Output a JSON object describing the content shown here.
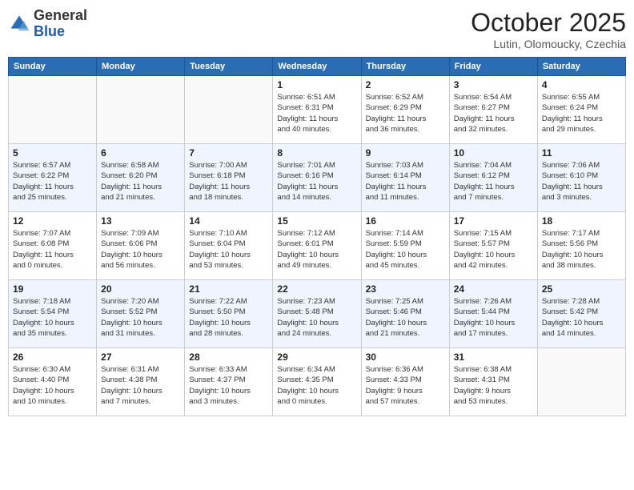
{
  "logo": {
    "general": "General",
    "blue": "Blue"
  },
  "header": {
    "month": "October 2025",
    "location": "Lutin, Olomoucky, Czechia"
  },
  "weekdays": [
    "Sunday",
    "Monday",
    "Tuesday",
    "Wednesday",
    "Thursday",
    "Friday",
    "Saturday"
  ],
  "weeks": [
    [
      {
        "day": "",
        "info": ""
      },
      {
        "day": "",
        "info": ""
      },
      {
        "day": "",
        "info": ""
      },
      {
        "day": "1",
        "info": "Sunrise: 6:51 AM\nSunset: 6:31 PM\nDaylight: 11 hours\nand 40 minutes."
      },
      {
        "day": "2",
        "info": "Sunrise: 6:52 AM\nSunset: 6:29 PM\nDaylight: 11 hours\nand 36 minutes."
      },
      {
        "day": "3",
        "info": "Sunrise: 6:54 AM\nSunset: 6:27 PM\nDaylight: 11 hours\nand 32 minutes."
      },
      {
        "day": "4",
        "info": "Sunrise: 6:55 AM\nSunset: 6:24 PM\nDaylight: 11 hours\nand 29 minutes."
      }
    ],
    [
      {
        "day": "5",
        "info": "Sunrise: 6:57 AM\nSunset: 6:22 PM\nDaylight: 11 hours\nand 25 minutes."
      },
      {
        "day": "6",
        "info": "Sunrise: 6:58 AM\nSunset: 6:20 PM\nDaylight: 11 hours\nand 21 minutes."
      },
      {
        "day": "7",
        "info": "Sunrise: 7:00 AM\nSunset: 6:18 PM\nDaylight: 11 hours\nand 18 minutes."
      },
      {
        "day": "8",
        "info": "Sunrise: 7:01 AM\nSunset: 6:16 PM\nDaylight: 11 hours\nand 14 minutes."
      },
      {
        "day": "9",
        "info": "Sunrise: 7:03 AM\nSunset: 6:14 PM\nDaylight: 11 hours\nand 11 minutes."
      },
      {
        "day": "10",
        "info": "Sunrise: 7:04 AM\nSunset: 6:12 PM\nDaylight: 11 hours\nand 7 minutes."
      },
      {
        "day": "11",
        "info": "Sunrise: 7:06 AM\nSunset: 6:10 PM\nDaylight: 11 hours\nand 3 minutes."
      }
    ],
    [
      {
        "day": "12",
        "info": "Sunrise: 7:07 AM\nSunset: 6:08 PM\nDaylight: 11 hours\nand 0 minutes."
      },
      {
        "day": "13",
        "info": "Sunrise: 7:09 AM\nSunset: 6:06 PM\nDaylight: 10 hours\nand 56 minutes."
      },
      {
        "day": "14",
        "info": "Sunrise: 7:10 AM\nSunset: 6:04 PM\nDaylight: 10 hours\nand 53 minutes."
      },
      {
        "day": "15",
        "info": "Sunrise: 7:12 AM\nSunset: 6:01 PM\nDaylight: 10 hours\nand 49 minutes."
      },
      {
        "day": "16",
        "info": "Sunrise: 7:14 AM\nSunset: 5:59 PM\nDaylight: 10 hours\nand 45 minutes."
      },
      {
        "day": "17",
        "info": "Sunrise: 7:15 AM\nSunset: 5:57 PM\nDaylight: 10 hours\nand 42 minutes."
      },
      {
        "day": "18",
        "info": "Sunrise: 7:17 AM\nSunset: 5:56 PM\nDaylight: 10 hours\nand 38 minutes."
      }
    ],
    [
      {
        "day": "19",
        "info": "Sunrise: 7:18 AM\nSunset: 5:54 PM\nDaylight: 10 hours\nand 35 minutes."
      },
      {
        "day": "20",
        "info": "Sunrise: 7:20 AM\nSunset: 5:52 PM\nDaylight: 10 hours\nand 31 minutes."
      },
      {
        "day": "21",
        "info": "Sunrise: 7:22 AM\nSunset: 5:50 PM\nDaylight: 10 hours\nand 28 minutes."
      },
      {
        "day": "22",
        "info": "Sunrise: 7:23 AM\nSunset: 5:48 PM\nDaylight: 10 hours\nand 24 minutes."
      },
      {
        "day": "23",
        "info": "Sunrise: 7:25 AM\nSunset: 5:46 PM\nDaylight: 10 hours\nand 21 minutes."
      },
      {
        "day": "24",
        "info": "Sunrise: 7:26 AM\nSunset: 5:44 PM\nDaylight: 10 hours\nand 17 minutes."
      },
      {
        "day": "25",
        "info": "Sunrise: 7:28 AM\nSunset: 5:42 PM\nDaylight: 10 hours\nand 14 minutes."
      }
    ],
    [
      {
        "day": "26",
        "info": "Sunrise: 6:30 AM\nSunset: 4:40 PM\nDaylight: 10 hours\nand 10 minutes."
      },
      {
        "day": "27",
        "info": "Sunrise: 6:31 AM\nSunset: 4:38 PM\nDaylight: 10 hours\nand 7 minutes."
      },
      {
        "day": "28",
        "info": "Sunrise: 6:33 AM\nSunset: 4:37 PM\nDaylight: 10 hours\nand 3 minutes."
      },
      {
        "day": "29",
        "info": "Sunrise: 6:34 AM\nSunset: 4:35 PM\nDaylight: 10 hours\nand 0 minutes."
      },
      {
        "day": "30",
        "info": "Sunrise: 6:36 AM\nSunset: 4:33 PM\nDaylight: 9 hours\nand 57 minutes."
      },
      {
        "day": "31",
        "info": "Sunrise: 6:38 AM\nSunset: 4:31 PM\nDaylight: 9 hours\nand 53 minutes."
      },
      {
        "day": "",
        "info": ""
      }
    ]
  ]
}
